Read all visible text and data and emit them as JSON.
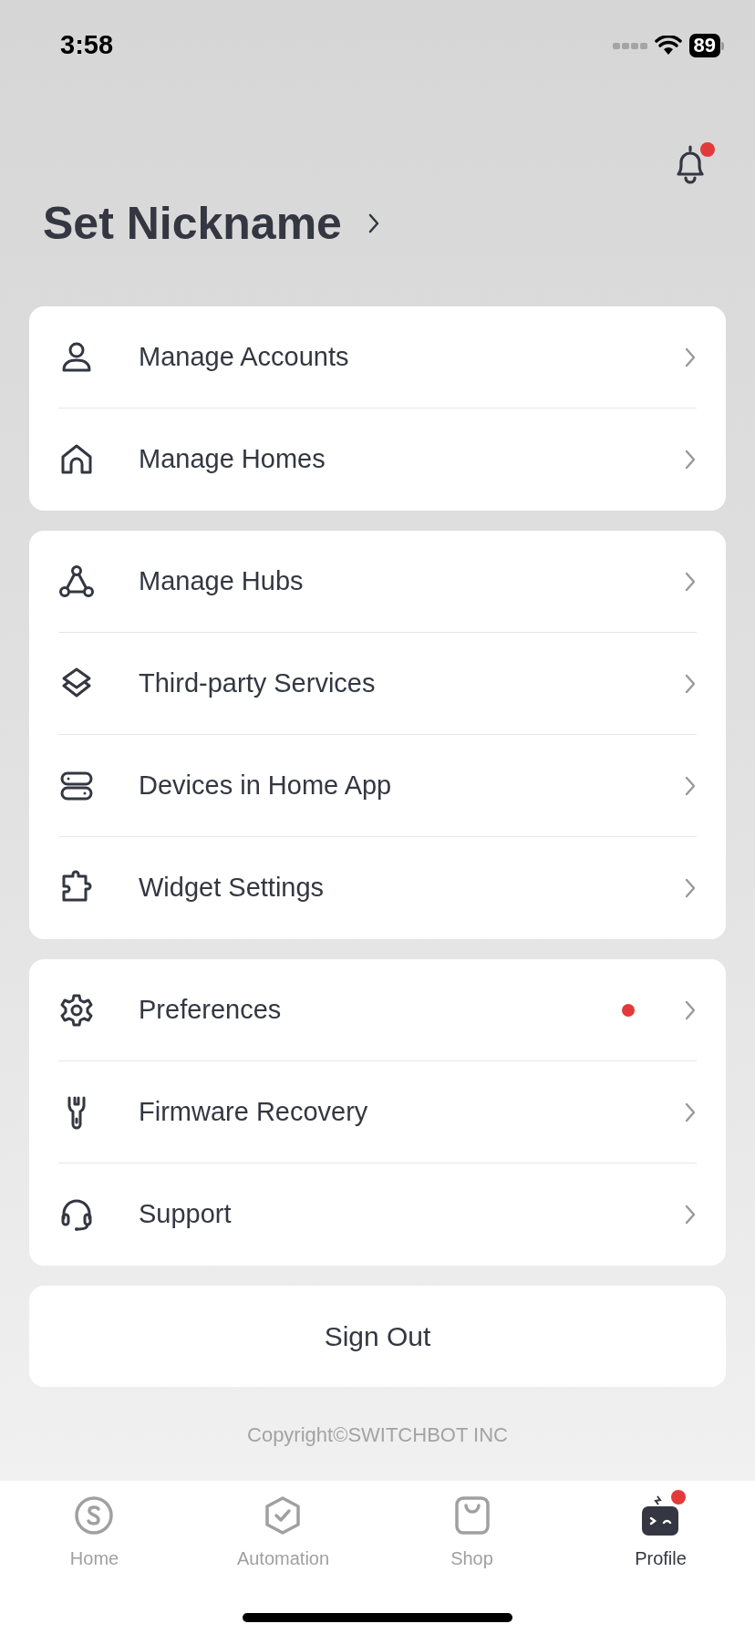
{
  "status_bar": {
    "time": "3:58",
    "battery": "89"
  },
  "header": {
    "notification_badge": true,
    "title": "Set Nickname"
  },
  "groups": [
    {
      "items": [
        {
          "label": "Manage Accounts",
          "badge": false
        },
        {
          "label": "Manage Homes",
          "badge": false
        }
      ]
    },
    {
      "items": [
        {
          "label": "Manage Hubs",
          "badge": false
        },
        {
          "label": "Third-party Services",
          "badge": false
        },
        {
          "label": "Devices in Home App",
          "badge": false
        },
        {
          "label": "Widget Settings",
          "badge": false
        }
      ]
    },
    {
      "items": [
        {
          "label": "Preferences",
          "badge": true
        },
        {
          "label": "Firmware Recovery",
          "badge": false
        },
        {
          "label": "Support",
          "badge": false
        }
      ]
    }
  ],
  "sign_out": "Sign Out",
  "copyright": "Copyright©SWITCHBOT INC",
  "tabs": [
    {
      "label": "Home",
      "selected": false,
      "badge": false
    },
    {
      "label": "Automation",
      "selected": false,
      "badge": false
    },
    {
      "label": "Shop",
      "selected": false,
      "badge": false
    },
    {
      "label": "Profile",
      "selected": true,
      "badge": true
    }
  ]
}
